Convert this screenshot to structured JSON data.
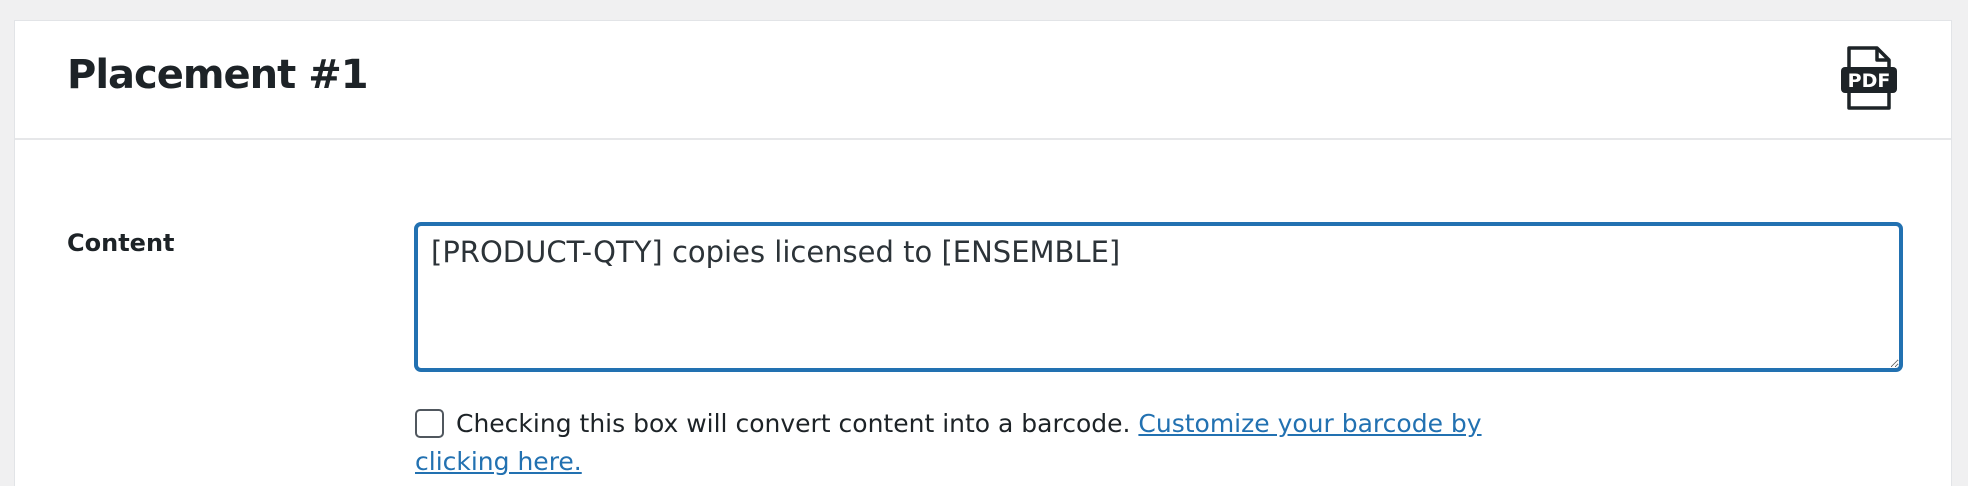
{
  "placement": {
    "title": "Placement #1",
    "pdf_icon": "pdf-file-icon",
    "pdf_icon_text": "PDF"
  },
  "content_field": {
    "label": "Content",
    "value": "[PRODUCT-QTY] copies licensed to [ENSEMBLE]",
    "placeholder": ""
  },
  "barcode": {
    "checked": false,
    "description": "Checking this box will convert content into a barcode.",
    "link_text": "Customize your barcode by clicking here."
  },
  "colors": {
    "accent": "#2271b1",
    "text": "#1d2327",
    "background": "#f0f0f1"
  }
}
